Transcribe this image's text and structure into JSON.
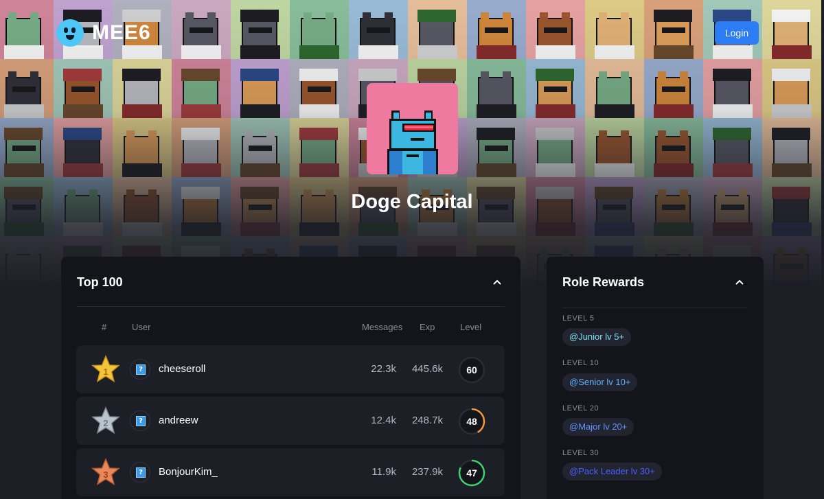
{
  "colors": {
    "accent": "#2b7cf5",
    "background": "#1c1e26",
    "panel": "#14151b",
    "row": "#1d1f27",
    "gold": "#f3c53a",
    "silver": "#b9c4cc",
    "bronze": "#e9875a",
    "level_ring_1": "#f29a3c",
    "level_ring_2": "#3ad46b",
    "role_junior": "#7fe0f5",
    "role_senior": "#5fb0ff",
    "role_major": "#5f93ff",
    "role_pack_leader": "#4a5fff"
  },
  "header": {
    "logo_text": "MEE6",
    "login_label": "Login"
  },
  "server": {
    "name": "Doge Capital"
  },
  "leaderboard": {
    "title": "Top 100",
    "columns": {
      "rank": "#",
      "user": "User",
      "messages": "Messages",
      "exp": "Exp",
      "level": "Level"
    },
    "rows": [
      {
        "rank": "1",
        "username": "cheeseroll",
        "messages": "22.3k",
        "exp": "445.6k",
        "level": "60",
        "level_progress": 0.0,
        "medal": "gold-star-icon"
      },
      {
        "rank": "2",
        "username": "andreew",
        "messages": "12.4k",
        "exp": "248.7k",
        "level": "48",
        "level_progress": 0.42,
        "medal": "silver-star-icon"
      },
      {
        "rank": "3",
        "username": "BonjourKim_",
        "messages": "11.9k",
        "exp": "237.9k",
        "level": "47",
        "level_progress": 0.82,
        "medal": "bronze-star-icon"
      }
    ]
  },
  "role_rewards": {
    "title": "Role Rewards",
    "items": [
      {
        "level_label": "LEVEL 5",
        "role": "@Junior lv 5+"
      },
      {
        "level_label": "LEVEL 10",
        "role": "@Senior lv 10+"
      },
      {
        "level_label": "LEVEL 20",
        "role": "@Major lv 20+"
      },
      {
        "level_label": "LEVEL 30",
        "role": "@Pack Leader lv 30+"
      }
    ]
  }
}
